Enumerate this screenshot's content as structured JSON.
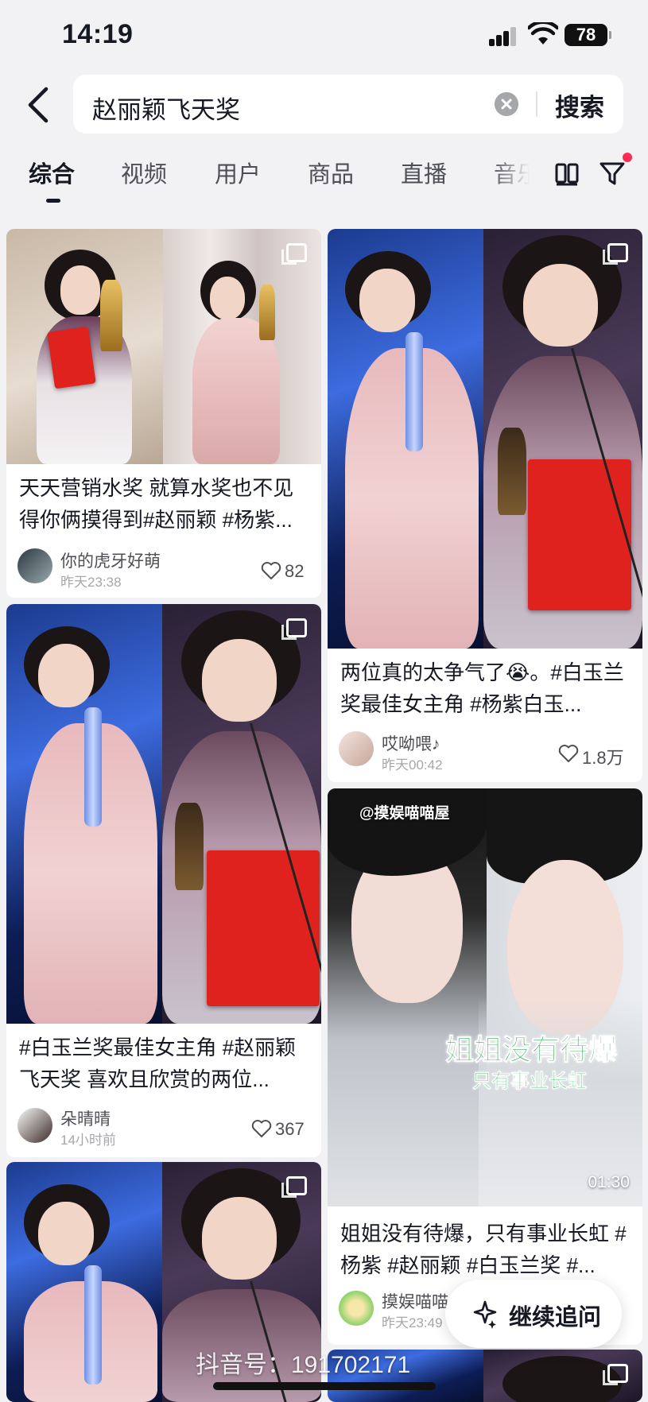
{
  "status_bar": {
    "time": "14:19",
    "battery": "78"
  },
  "search": {
    "query": "赵丽颖飞天奖",
    "button_label": "搜索"
  },
  "tabs": [
    {
      "label": "综合"
    },
    {
      "label": "视频"
    },
    {
      "label": "用户"
    },
    {
      "label": "商品"
    },
    {
      "label": "直播"
    },
    {
      "label": "音乐"
    }
  ],
  "cards": [
    {
      "title": "天天营销水奖 就算水奖也不见得你俩摸得到#赵丽颖 #杨紫...",
      "author": "你的虎牙好萌",
      "time": "昨天23:38",
      "likes": "82",
      "media": "gallery-icon"
    },
    {
      "title": "两位真的太争气了😭。#白玉兰奖最佳女主角 #杨紫白玉...",
      "author": "哎呦喂♪",
      "time": "昨天00:42",
      "likes": "1.8万",
      "media": "gallery-icon"
    },
    {
      "title": "#白玉兰奖最佳女主角  #赵丽颖飞天奖 喜欢且欣赏的两位...",
      "author": "朵晴晴",
      "time": "14小时前",
      "likes": "367",
      "media": "gallery-icon"
    },
    {
      "title": "姐姐没有待爆，只有事业长虹 #杨紫 #赵丽颖 #白玉兰奖 #...",
      "author": "摸娱喵喵",
      "time": "昨天23:49",
      "duration": "01:30",
      "overlay_tag": "@摸娱喵喵屋",
      "overlay_line1": "姐姐没有待爆",
      "overlay_line2": "只有事业长虹",
      "media": "video"
    },
    {
      "media": "gallery-icon"
    },
    {
      "media": "gallery-icon"
    }
  ],
  "floating": {
    "ask_label": "继续追问",
    "watermark": "抖音号：191702171"
  },
  "colors": {
    "accent": "#fe2c55",
    "text": "#161823",
    "secondary": "#a6a7ab"
  }
}
